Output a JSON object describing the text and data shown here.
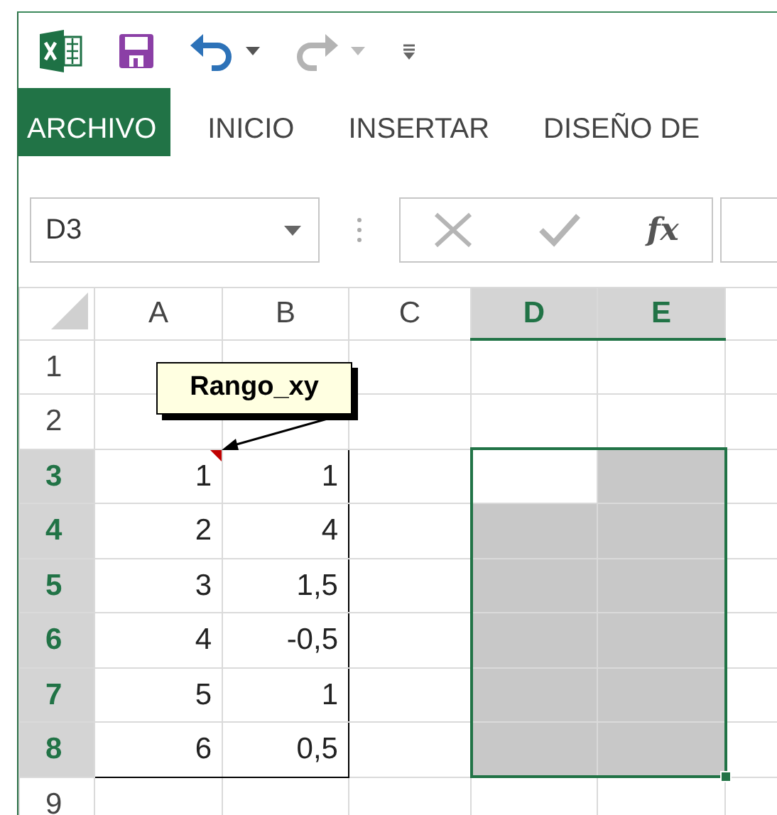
{
  "ribbon_tabs": [
    {
      "label": "ARCHIVO",
      "kind": "file"
    },
    {
      "label": "INICIO",
      "kind": "tab"
    },
    {
      "label": "INSERTAR",
      "kind": "tab"
    },
    {
      "label": "DISEÑO DE",
      "kind": "tab"
    }
  ],
  "name_box": {
    "value": "D3"
  },
  "formula_bar": {
    "function_label": "fx"
  },
  "columns": [
    {
      "label": "A",
      "selected": false
    },
    {
      "label": "B",
      "selected": false
    },
    {
      "label": "C",
      "selected": false
    },
    {
      "label": "D",
      "selected": true
    },
    {
      "label": "E",
      "selected": true
    }
  ],
  "rows": [
    {
      "label": "1",
      "selected": false,
      "cells": [
        {
          "in_range": false,
          "selected": false
        },
        {
          "in_range": false,
          "selected": false
        },
        {
          "in_range": false,
          "selected": false
        },
        {
          "in_range": false,
          "selected": false
        },
        {
          "in_range": false,
          "selected": false
        }
      ]
    },
    {
      "label": "2",
      "selected": false,
      "cells": [
        {
          "in_range": false,
          "selected": false
        },
        {
          "in_range": false,
          "selected": false
        },
        {
          "in_range": false,
          "selected": false
        },
        {
          "in_range": false,
          "selected": false
        },
        {
          "in_range": false,
          "selected": false
        }
      ]
    },
    {
      "label": "3",
      "selected": true,
      "cells": [
        {
          "value": "1",
          "in_range": true,
          "selected": false,
          "comment": "Rango_xy"
        },
        {
          "value": "1",
          "in_range": true,
          "selected": false
        },
        {
          "in_range": false,
          "selected": false
        },
        {
          "in_range": false,
          "selected": true,
          "active": true
        },
        {
          "in_range": false,
          "selected": true
        }
      ]
    },
    {
      "label": "4",
      "selected": true,
      "cells": [
        {
          "value": "2",
          "in_range": true,
          "selected": false
        },
        {
          "value": "4",
          "in_range": true,
          "selected": false
        },
        {
          "in_range": false,
          "selected": false
        },
        {
          "in_range": false,
          "selected": true
        },
        {
          "in_range": false,
          "selected": true
        }
      ]
    },
    {
      "label": "5",
      "selected": true,
      "cells": [
        {
          "value": "3",
          "in_range": true,
          "selected": false
        },
        {
          "value": "1,5",
          "in_range": true,
          "selected": false
        },
        {
          "in_range": false,
          "selected": false
        },
        {
          "in_range": false,
          "selected": true
        },
        {
          "in_range": false,
          "selected": true
        }
      ]
    },
    {
      "label": "6",
      "selected": true,
      "cells": [
        {
          "value": "4",
          "in_range": true,
          "selected": false
        },
        {
          "value": "-0,5",
          "in_range": true,
          "selected": false
        },
        {
          "in_range": false,
          "selected": false
        },
        {
          "in_range": false,
          "selected": true
        },
        {
          "in_range": false,
          "selected": true
        }
      ]
    },
    {
      "label": "7",
      "selected": true,
      "cells": [
        {
          "value": "5",
          "in_range": true,
          "selected": false
        },
        {
          "value": "1",
          "in_range": true,
          "selected": false
        },
        {
          "in_range": false,
          "selected": false
        },
        {
          "in_range": false,
          "selected": true
        },
        {
          "in_range": false,
          "selected": true
        }
      ]
    },
    {
      "label": "8",
      "selected": true,
      "cells": [
        {
          "value": "6",
          "in_range": true,
          "selected": false
        },
        {
          "value": "0,5",
          "in_range": true,
          "selected": false
        },
        {
          "in_range": false,
          "selected": false
        },
        {
          "in_range": false,
          "selected": true
        },
        {
          "in_range": false,
          "selected": true
        }
      ]
    },
    {
      "label": "9",
      "selected": false,
      "cells": [
        {
          "in_range": false,
          "selected": false
        },
        {
          "in_range": false,
          "selected": false
        },
        {
          "in_range": false,
          "selected": false
        },
        {
          "in_range": false,
          "selected": false
        },
        {
          "in_range": false,
          "selected": false
        }
      ]
    }
  ]
}
